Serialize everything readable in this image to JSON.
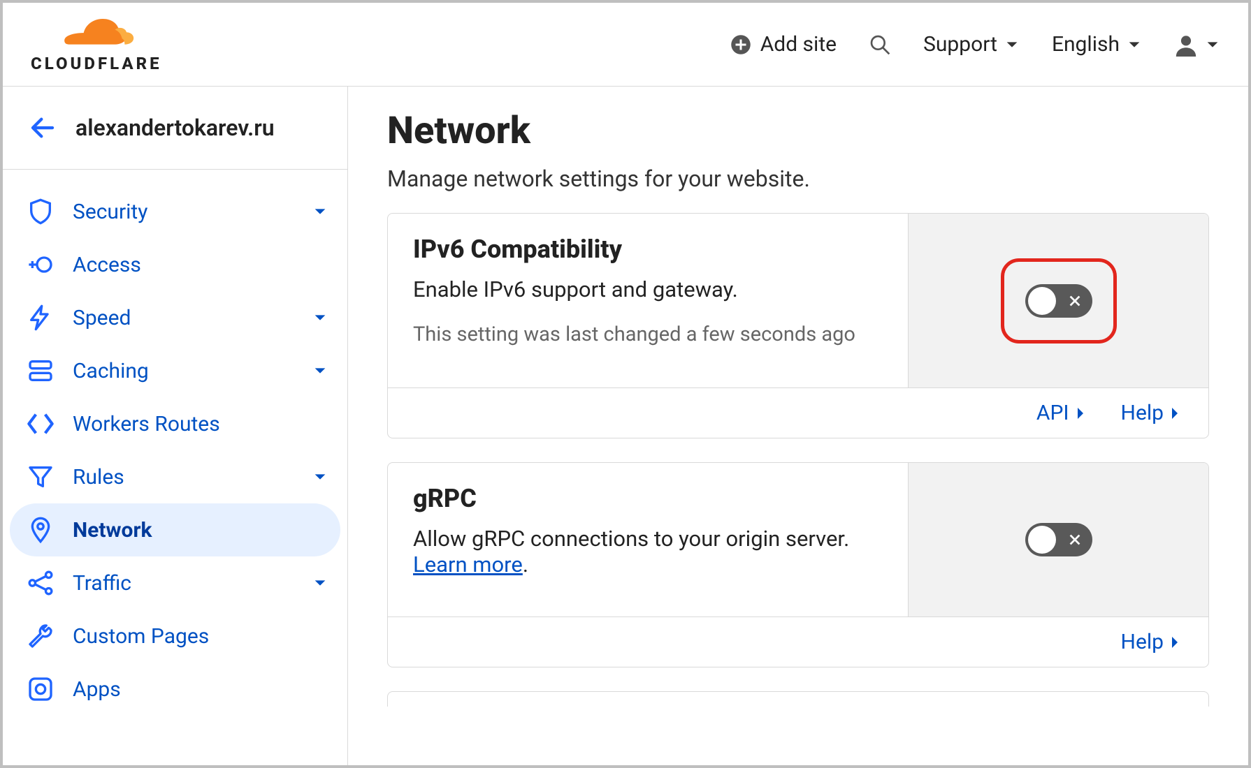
{
  "header": {
    "brand": "CLOUDFLARE",
    "add_site": "Add site",
    "support": "Support",
    "language": "English"
  },
  "sidebar": {
    "site": "alexandertokarev.ru",
    "items": [
      {
        "label": "Security",
        "exp": true,
        "icon": "shield"
      },
      {
        "label": "Access",
        "exp": false,
        "icon": "access"
      },
      {
        "label": "Speed",
        "exp": true,
        "icon": "bolt"
      },
      {
        "label": "Caching",
        "exp": true,
        "icon": "stack"
      },
      {
        "label": "Workers Routes",
        "exp": false,
        "icon": "brackets"
      },
      {
        "label": "Rules",
        "exp": true,
        "icon": "funnel"
      },
      {
        "label": "Network",
        "exp": false,
        "icon": "pin",
        "active": true
      },
      {
        "label": "Traffic",
        "exp": true,
        "icon": "share"
      },
      {
        "label": "Custom Pages",
        "exp": false,
        "icon": "wrench"
      },
      {
        "label": "Apps",
        "exp": false,
        "icon": "apps"
      }
    ]
  },
  "page": {
    "title": "Network",
    "subtitle": "Manage network settings for your website.",
    "api_label": "API",
    "help_label": "Help"
  },
  "cards": {
    "ipv6": {
      "title": "IPv6 Compatibility",
      "desc": "Enable IPv6 support and gateway.",
      "note": "This setting was last changed a few seconds ago",
      "toggle_state": "off"
    },
    "grpc": {
      "title": "gRPC",
      "desc_prefix": "Allow gRPC connections to your origin server. ",
      "learn_more": "Learn more",
      "desc_suffix": ".",
      "toggle_state": "off"
    }
  }
}
